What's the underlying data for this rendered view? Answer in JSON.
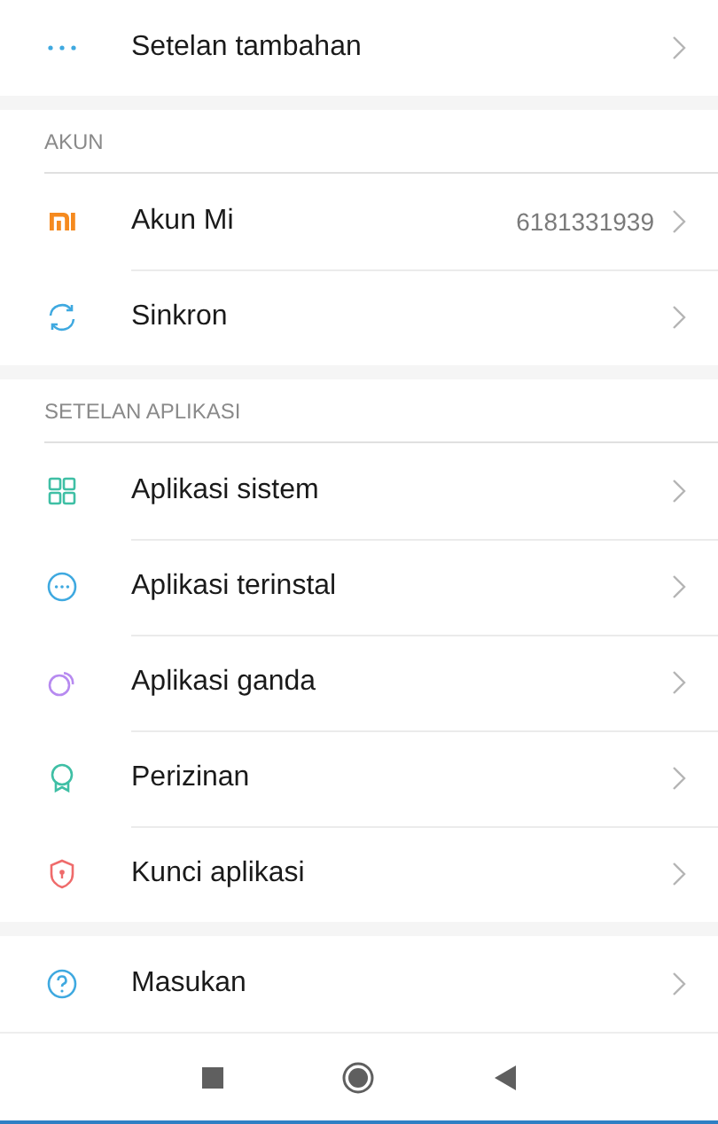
{
  "sections": [
    {
      "items": [
        {
          "kind": "more",
          "label": "Setelan tambahan"
        }
      ]
    },
    {
      "header": "AKUN",
      "items": [
        {
          "kind": "mi",
          "label": "Akun Mi",
          "value": "6181331939"
        },
        {
          "kind": "sync",
          "label": "Sinkron"
        }
      ]
    },
    {
      "header": "SETELAN APLIKASI",
      "items": [
        {
          "kind": "grid",
          "label": "Aplikasi sistem"
        },
        {
          "kind": "apps",
          "label": "Aplikasi terinstal"
        },
        {
          "kind": "dual",
          "label": "Aplikasi ganda"
        },
        {
          "kind": "badge",
          "label": "Perizinan"
        },
        {
          "kind": "shield",
          "label": "Kunci aplikasi"
        }
      ]
    },
    {
      "items": [
        {
          "kind": "help",
          "label": "Masukan"
        }
      ]
    }
  ]
}
